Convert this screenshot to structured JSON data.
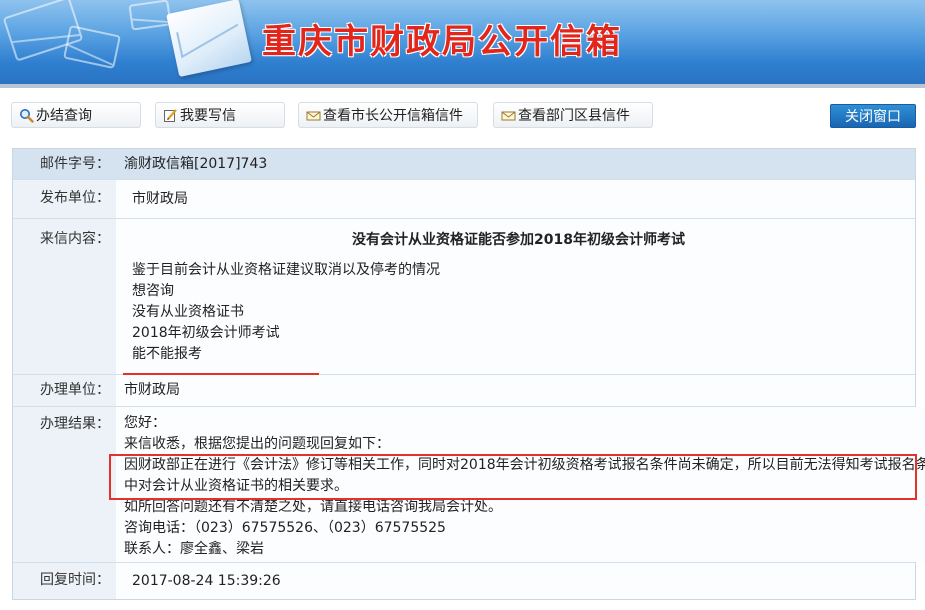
{
  "banner": {
    "title": "重庆市财政局公开信箱"
  },
  "toolbar": {
    "search_label": "办结查询",
    "write_label": "我要写信",
    "mayor_mail_label": "查看市长公开信箱信件",
    "dept_mail_label": "查看部门区县信件",
    "close_label": "关闭窗口"
  },
  "icons": {
    "search": "magnifier-icon",
    "write": "pencil-icon",
    "mayor_mail": "mail-icon",
    "dept_mail": "mail-icon"
  },
  "record": {
    "mail_no_label": "邮件字号：",
    "mail_no": "渝财政信箱[2017]743",
    "publisher_label": "发布单位：",
    "publisher": "市财政局",
    "content_label": "来信内容：",
    "content_title": "没有会计从业资格证能否参加2018年初级会计师考试",
    "content_lines": [
      "鉴于目前会计从业资格证建议取消以及停考的情况",
      "想咨询",
      "没有从业资格证书",
      "2018年初级会计师考试",
      "能不能报考"
    ],
    "handler_label": "办理单位：",
    "handler": "市财政局",
    "result_label": "办理结果：",
    "result_lines": [
      "您好：",
      "来信收悉，根据您提出的问题现回复如下：",
      "因财政部正在进行《会计法》修订等相关工作，同时对2018年会计初级资格考试报名条件尚未确定，所以目前无法得知考试报名条件",
      "中对会计从业资格证书的相关要求。",
      "如所回答问题还有不清楚之处，请直接电话咨询我局会计处。",
      "咨询电话：（023）67575526、（023）67575525",
      "联系人：廖全鑫、梁岩"
    ],
    "reply_time_label": "回复时间：",
    "reply_time": "2017-08-24 15:39:26"
  },
  "colors": {
    "banner_title": "#e2261b",
    "highlight_box": "#e4312a",
    "close_button": "#1f73c2"
  }
}
